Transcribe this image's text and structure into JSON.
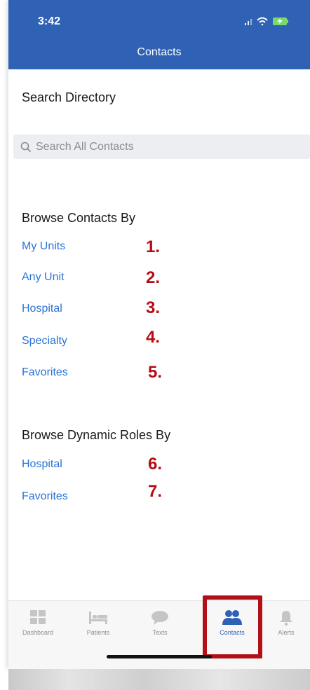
{
  "status_bar": {
    "time": "3:42"
  },
  "nav": {
    "title": "Contacts"
  },
  "search": {
    "section_title": "Search Directory",
    "placeholder": "Search All Contacts"
  },
  "browse_contacts": {
    "title": "Browse Contacts By",
    "items": [
      {
        "label": "My Units",
        "marker": "1."
      },
      {
        "label": "Any Unit",
        "marker": "2."
      },
      {
        "label": "Hospital",
        "marker": "3."
      },
      {
        "label": "Specialty",
        "marker": "4."
      },
      {
        "label": "Favorites",
        "marker": "5."
      }
    ]
  },
  "browse_roles": {
    "title": "Browse Dynamic Roles By",
    "items": [
      {
        "label": "Hospital",
        "marker": "6."
      },
      {
        "label": "Favorites",
        "marker": "7."
      }
    ]
  },
  "tabbar": {
    "active": "Contacts",
    "tabs": [
      {
        "label": "Dashboard",
        "icon": "grid-icon"
      },
      {
        "label": "Patients",
        "icon": "bed-icon"
      },
      {
        "label": "Texts",
        "icon": "speech-bubble-icon"
      },
      {
        "label": "Contacts",
        "icon": "people-icon"
      },
      {
        "label": "Alerts",
        "icon": "bell-icon"
      }
    ]
  },
  "colors": {
    "header": "#2f62b5",
    "link": "#2b74d4",
    "annotation": "#b40d14"
  }
}
